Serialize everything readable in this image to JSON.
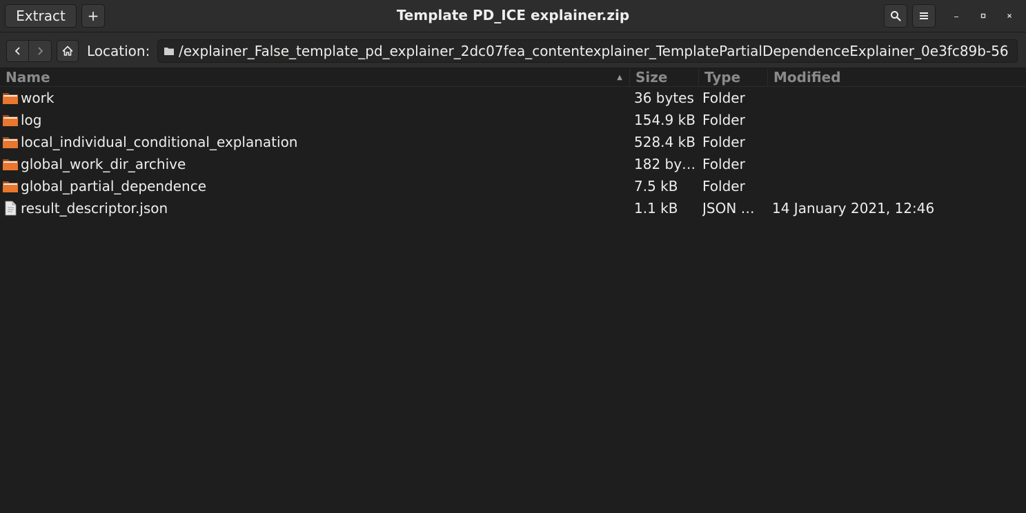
{
  "header": {
    "extract_label": "Extract",
    "new_label": "+",
    "title": "Template PD_ICE explainer.zip"
  },
  "location": {
    "label": "Location:",
    "path": "/explainer_False_template_pd_explainer_2dc07fea_contentexplainer_TemplatePartialDependenceExplainer_0e3fc89b-56"
  },
  "columns": {
    "name": "Name",
    "size": "Size",
    "type": "Type",
    "modified": "Modified"
  },
  "rows": [
    {
      "icon": "folder-icon",
      "name": "work",
      "size": "36 bytes",
      "type": "Folder",
      "modified": ""
    },
    {
      "icon": "folder-icon",
      "name": "log",
      "size": "154.9 kB",
      "type": "Folder",
      "modified": ""
    },
    {
      "icon": "folder-icon",
      "name": "local_individual_conditional_explanation",
      "size": "528.4 kB",
      "type": "Folder",
      "modified": ""
    },
    {
      "icon": "folder-icon",
      "name": "global_work_dir_archive",
      "size": "182 by…",
      "type": "Folder",
      "modified": ""
    },
    {
      "icon": "folder-icon",
      "name": "global_partial_dependence",
      "size": "7.5 kB",
      "type": "Folder",
      "modified": ""
    },
    {
      "icon": "document-icon",
      "name": "result_descriptor.json",
      "size": "1.1 kB",
      "type": "JSON …",
      "modified": "14 January 2021, 12:46"
    }
  ],
  "colors": {
    "folder_orange": "#e9772e",
    "background": "#1e1e1e",
    "headerbar": "#2d2d2d"
  }
}
